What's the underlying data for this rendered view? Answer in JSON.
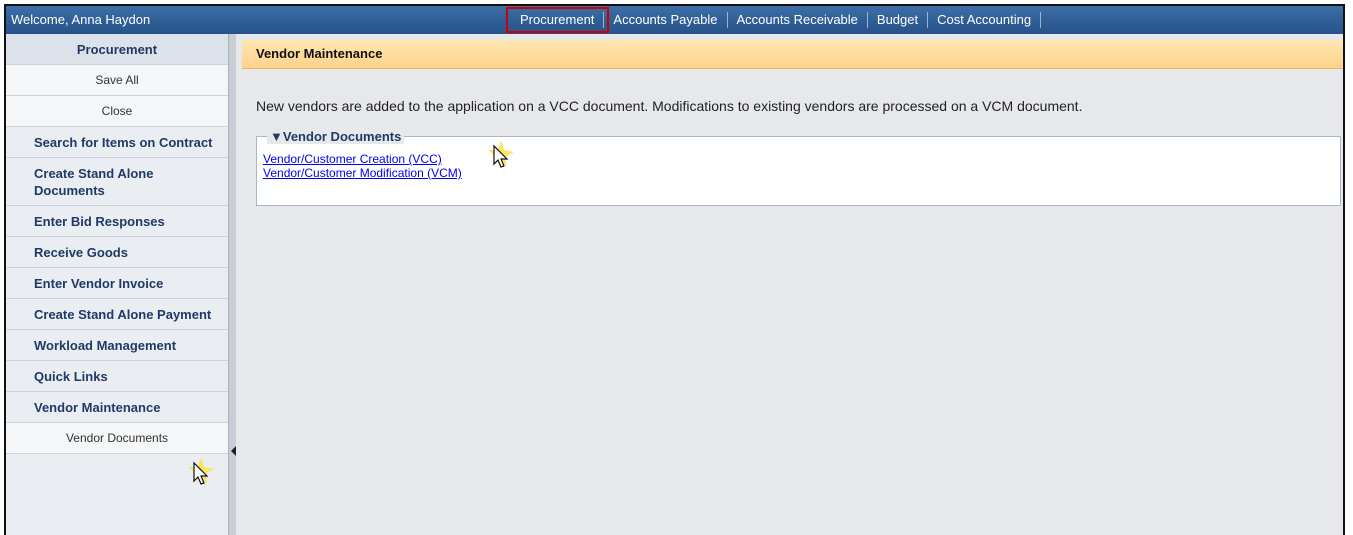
{
  "header": {
    "welcome": "Welcome, Anna Haydon",
    "tabs": [
      "Procurement",
      "Accounts Payable",
      "Accounts Receivable",
      "Budget",
      "Cost Accounting"
    ],
    "active_tab": "Procurement"
  },
  "sidebar": {
    "title": "Procurement",
    "items": [
      {
        "label": "Save All"
      },
      {
        "label": "Close"
      },
      {
        "label": "Search for Items on Contract"
      },
      {
        "label": "Create Stand Alone Documents"
      },
      {
        "label": "Enter Bid Responses"
      },
      {
        "label": "Receive Goods"
      },
      {
        "label": "Enter Vendor Invoice"
      },
      {
        "label": "Create Stand Alone Payment"
      },
      {
        "label": "Workload Management"
      },
      {
        "label": "Quick Links"
      },
      {
        "label": "Vendor Maintenance"
      },
      {
        "label": "Vendor Documents"
      }
    ]
  },
  "main": {
    "title": "Vendor Maintenance",
    "intro": "New vendors are added to the application on a VCC document. Modifications to existing vendors are processed on a VCM document.",
    "section_title": "Vendor Documents",
    "links": [
      {
        "label": "Vendor/Customer Creation (VCC)"
      },
      {
        "label": "Vendor/Customer Modification (VCM)"
      }
    ]
  },
  "colors": {
    "topbar": "#2f5e96",
    "title_bar": "#fdd38a",
    "link": "#0000ee",
    "active_tab_outline": "#cc0000"
  }
}
